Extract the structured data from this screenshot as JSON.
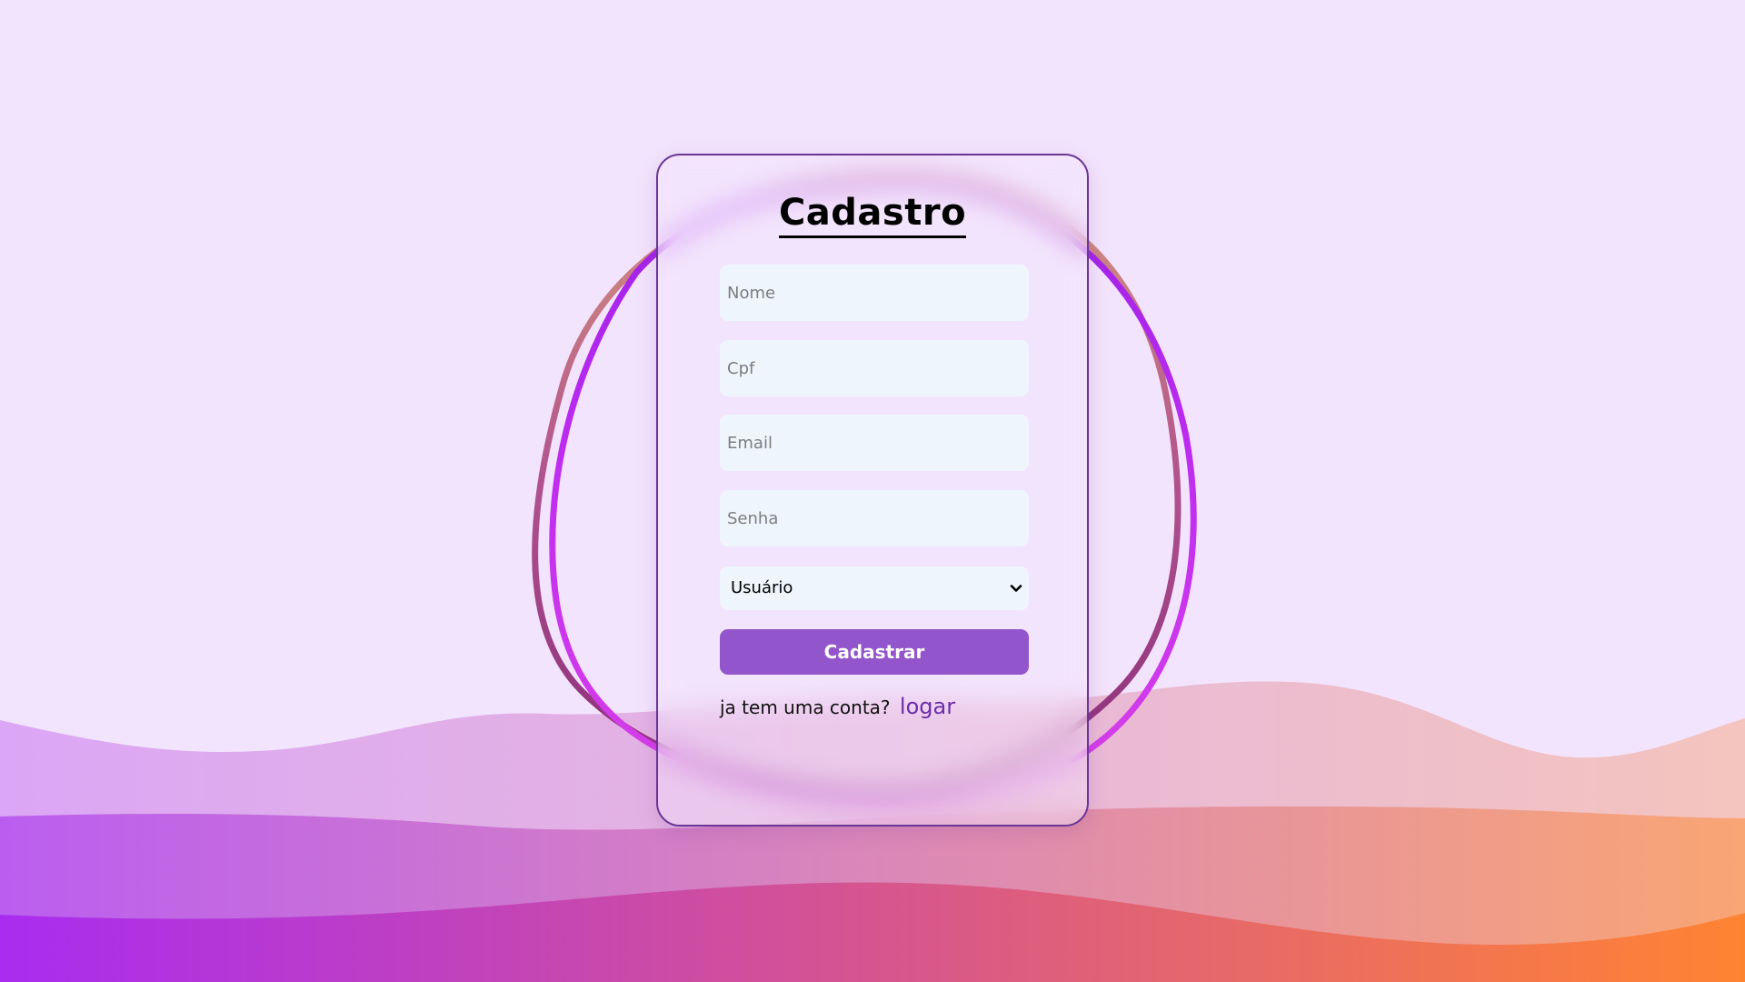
{
  "form": {
    "title": "Cadastro",
    "fields": {
      "nome_placeholder": "Nome",
      "cpf_placeholder": "Cpf",
      "email_placeholder": "Email",
      "senha_placeholder": "Senha"
    },
    "role_select": {
      "selected": "Usuário"
    },
    "submit_label": "Cadastrar",
    "login_prompt": "ja tem uma conta?",
    "login_link": "logar"
  },
  "colors": {
    "background": "#f3e4fd",
    "card_border": "#6a3596",
    "input_background": "#eff5fd",
    "button": "#9355cb",
    "link": "#6c2ea8",
    "wave_left": "#a92cf0",
    "wave_right": "#ff8432"
  },
  "icons": {
    "select_arrow": "chevron-down-icon"
  }
}
